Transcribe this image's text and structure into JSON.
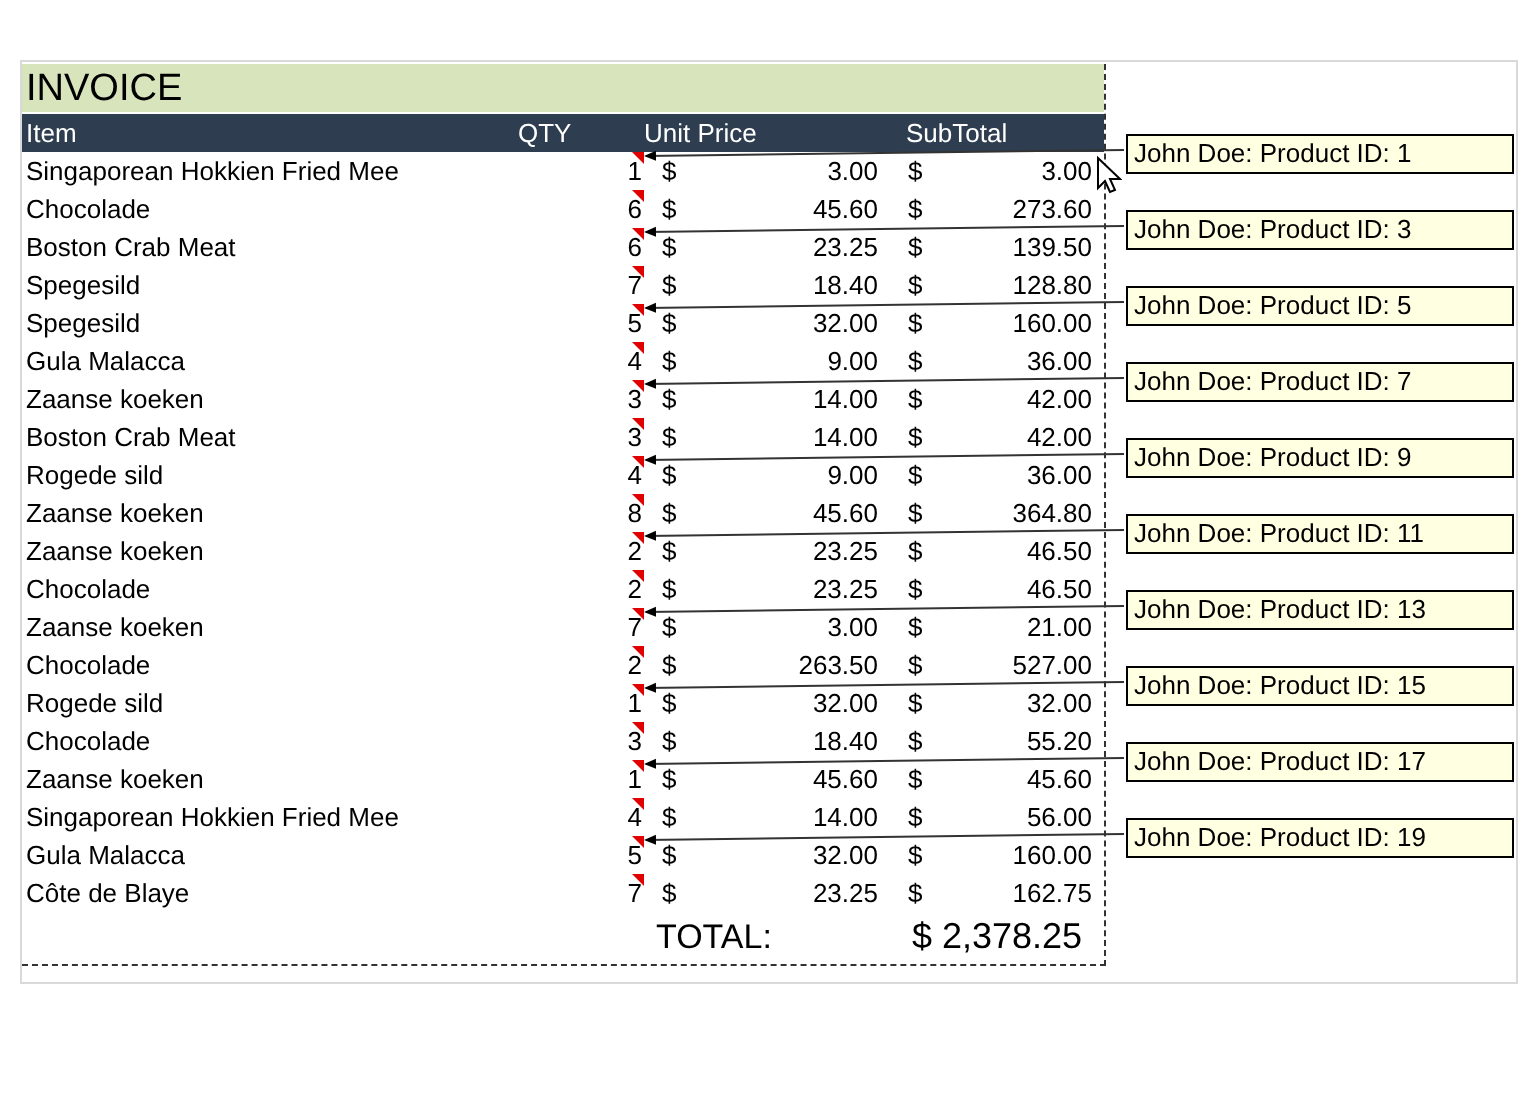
{
  "title": "INVOICE",
  "columns": [
    {
      "label": "Item"
    },
    {
      "label": "QTY"
    },
    {
      "label": "Unit Price"
    },
    {
      "label": "SubTotal"
    }
  ],
  "rows": [
    {
      "item": "Singaporean Hokkien Fried Mee",
      "qty": "1",
      "has_comment": true,
      "unit_currency": "$",
      "unit_price": "3.00",
      "subtotal_currency": "$",
      "subtotal": "3.00",
      "comment": "John Doe: Product ID: 1"
    },
    {
      "item": "Chocolade",
      "qty": "6",
      "has_comment": true,
      "unit_currency": "$",
      "unit_price": "45.60",
      "subtotal_currency": "$",
      "subtotal": "273.60"
    },
    {
      "item": "Boston Crab Meat",
      "qty": "6",
      "has_comment": true,
      "unit_currency": "$",
      "unit_price": "23.25",
      "subtotal_currency": "$",
      "subtotal": "139.50",
      "comment": "John Doe: Product ID: 3"
    },
    {
      "item": "Spegesild",
      "qty": "7",
      "has_comment": true,
      "unit_currency": "$",
      "unit_price": "18.40",
      "subtotal_currency": "$",
      "subtotal": "128.80"
    },
    {
      "item": "Spegesild",
      "qty": "5",
      "has_comment": true,
      "unit_currency": "$",
      "unit_price": "32.00",
      "subtotal_currency": "$",
      "subtotal": "160.00",
      "comment": "John Doe: Product ID: 5"
    },
    {
      "item": "Gula Malacca",
      "qty": "4",
      "has_comment": true,
      "unit_currency": "$",
      "unit_price": "9.00",
      "subtotal_currency": "$",
      "subtotal": "36.00"
    },
    {
      "item": "Zaanse koeken",
      "qty": "3",
      "has_comment": true,
      "unit_currency": "$",
      "unit_price": "14.00",
      "subtotal_currency": "$",
      "subtotal": "42.00",
      "comment": "John Doe: Product ID: 7"
    },
    {
      "item": "Boston Crab Meat",
      "qty": "3",
      "has_comment": true,
      "unit_currency": "$",
      "unit_price": "14.00",
      "subtotal_currency": "$",
      "subtotal": "42.00"
    },
    {
      "item": "Rogede sild",
      "qty": "4",
      "has_comment": true,
      "unit_currency": "$",
      "unit_price": "9.00",
      "subtotal_currency": "$",
      "subtotal": "36.00",
      "comment": "John Doe: Product ID: 9"
    },
    {
      "item": "Zaanse koeken",
      "qty": "8",
      "has_comment": true,
      "unit_currency": "$",
      "unit_price": "45.60",
      "subtotal_currency": "$",
      "subtotal": "364.80"
    },
    {
      "item": "Zaanse koeken",
      "qty": "2",
      "has_comment": true,
      "unit_currency": "$",
      "unit_price": "23.25",
      "subtotal_currency": "$",
      "subtotal": "46.50",
      "comment": "John Doe: Product ID: 11"
    },
    {
      "item": "Chocolade",
      "qty": "2",
      "has_comment": true,
      "unit_currency": "$",
      "unit_price": "23.25",
      "subtotal_currency": "$",
      "subtotal": "46.50"
    },
    {
      "item": "Zaanse koeken",
      "qty": "7",
      "has_comment": true,
      "unit_currency": "$",
      "unit_price": "3.00",
      "subtotal_currency": "$",
      "subtotal": "21.00",
      "comment": "John Doe: Product ID: 13"
    },
    {
      "item": "Chocolade",
      "qty": "2",
      "has_comment": true,
      "unit_currency": "$",
      "unit_price": "263.50",
      "subtotal_currency": "$",
      "subtotal": "527.00"
    },
    {
      "item": "Rogede sild",
      "qty": "1",
      "has_comment": true,
      "unit_currency": "$",
      "unit_price": "32.00",
      "subtotal_currency": "$",
      "subtotal": "32.00",
      "comment": "John Doe: Product ID: 15"
    },
    {
      "item": "Chocolade",
      "qty": "3",
      "has_comment": true,
      "unit_currency": "$",
      "unit_price": "18.40",
      "subtotal_currency": "$",
      "subtotal": "55.20"
    },
    {
      "item": "Zaanse koeken",
      "qty": "1",
      "has_comment": true,
      "unit_currency": "$",
      "unit_price": "45.60",
      "subtotal_currency": "$",
      "subtotal": "45.60",
      "comment": "John Doe: Product ID: 17"
    },
    {
      "item": "Singaporean Hokkien Fried Mee",
      "qty": "4",
      "has_comment": true,
      "unit_currency": "$",
      "unit_price": "14.00",
      "subtotal_currency": "$",
      "subtotal": "56.00"
    },
    {
      "item": "Gula Malacca",
      "qty": "5",
      "has_comment": true,
      "unit_currency": "$",
      "unit_price": "32.00",
      "subtotal_currency": "$",
      "subtotal": "160.00",
      "comment": "John Doe: Product ID: 19"
    },
    {
      "item": "Côte de Blaye",
      "qty": "7",
      "has_comment": true,
      "unit_currency": "$",
      "unit_price": "23.25",
      "subtotal_currency": "$",
      "subtotal": "162.75"
    }
  ],
  "total": {
    "label": "TOTAL:",
    "value": "$ 2,378.25"
  }
}
